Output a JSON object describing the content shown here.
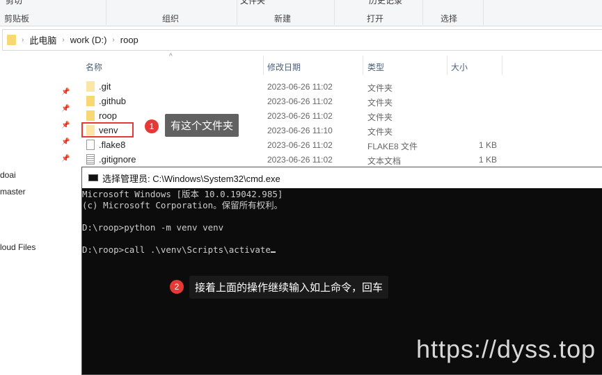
{
  "ribbon": {
    "top_items": [
      "剪切",
      "文件夹",
      "历史记录"
    ],
    "groups": [
      "剪贴板",
      "组织",
      "新建",
      "打开",
      "选择"
    ]
  },
  "address": {
    "crumbs": [
      "此电脑",
      "work (D:)",
      "roop"
    ]
  },
  "columns": {
    "name": "名称",
    "date": "修改日期",
    "type": "类型",
    "size": "大小"
  },
  "files": [
    {
      "name": ".git",
      "date": "2023-06-26 11:02",
      "type": "文件夹",
      "size": "",
      "icon": "folder-light"
    },
    {
      "name": ".github",
      "date": "2023-06-26 11:02",
      "type": "文件夹",
      "size": "",
      "icon": "folder"
    },
    {
      "name": "roop",
      "date": "2023-06-26 11:02",
      "type": "文件夹",
      "size": "",
      "icon": "folder"
    },
    {
      "name": "venv",
      "date": "2023-06-26 11:10",
      "type": "文件夹",
      "size": "",
      "icon": "folder-light"
    },
    {
      "name": ".flake8",
      "date": "2023-06-26 11:02",
      "type": "FLAKE8 文件",
      "size": "1 KB",
      "icon": "file"
    },
    {
      "name": ".gitignore",
      "date": "2023-06-26 11:02",
      "type": "文本文档",
      "size": "1 KB",
      "icon": "text-file"
    }
  ],
  "sidebar": [
    "doai",
    "master",
    "loud Files"
  ],
  "annotations": [
    {
      "number": "1",
      "text": "有这个文件夹"
    },
    {
      "number": "2",
      "text": "接着上面的操作继续输入如上命令，回车"
    }
  ],
  "cmd": {
    "title": "选择管理员: C:\\Windows\\System32\\cmd.exe",
    "lines": [
      "Microsoft Windows [版本 10.0.19042.985]",
      "(c) Microsoft Corporation。保留所有权利。",
      "",
      "D:\\roop>python -m venv venv",
      "",
      "D:\\roop>call .\\venv\\Scripts\\activate"
    ]
  },
  "watermark": "https://dyss.top",
  "colors": {
    "highlight": "#e53935",
    "tooltip": "#616161",
    "folder": "#f8d775"
  }
}
